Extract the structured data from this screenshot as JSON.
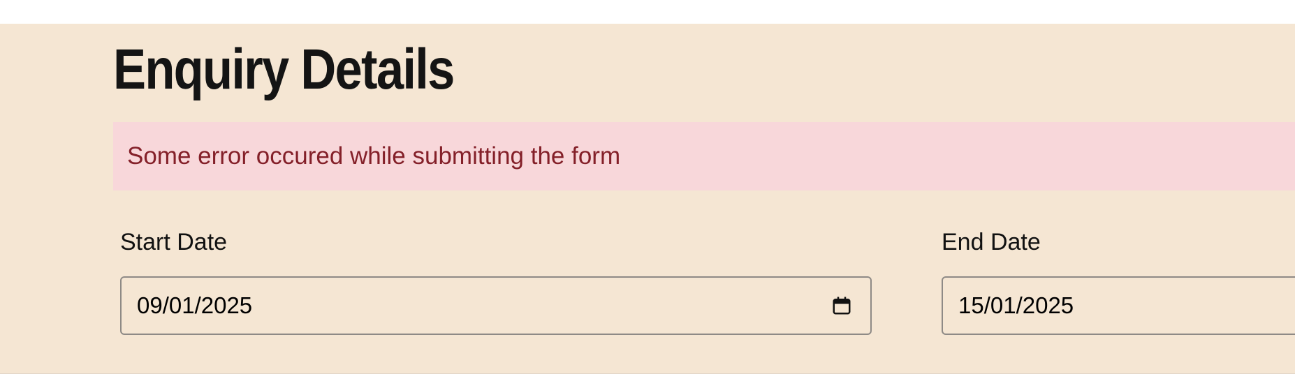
{
  "page": {
    "title": "Enquiry Details"
  },
  "alert": {
    "message": "Some error occured while submitting the form",
    "background": "#f8d7da",
    "text_color": "#842029"
  },
  "form": {
    "start_date": {
      "label": "Start Date",
      "value": "09/01/2025",
      "icon": "calendar-icon"
    },
    "end_date": {
      "label": "End Date",
      "value": "15/01/2025",
      "icon": "calendar-icon"
    }
  },
  "colors": {
    "panel_background": "#f5e6d3",
    "input_border": "#8e8a86"
  }
}
